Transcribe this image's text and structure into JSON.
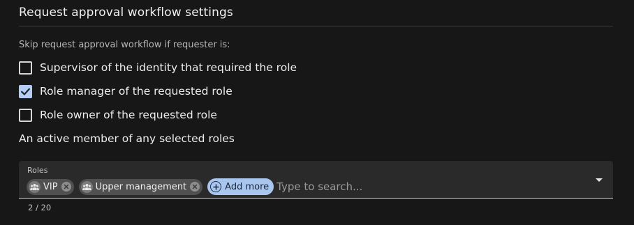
{
  "section": {
    "title": "Request approval workflow settings",
    "subheading": "Skip request approval workflow if requester is:"
  },
  "options": [
    {
      "label": "Supervisor of the identity that required the role",
      "checked": false
    },
    {
      "label": "Role manager of the requested role",
      "checked": true
    },
    {
      "label": "Role owner of the requested role",
      "checked": false
    }
  ],
  "active_member_label": "An active member of any selected roles",
  "roles_field": {
    "label": "Roles",
    "chips": [
      {
        "text": "VIP",
        "icon": "group-icon"
      },
      {
        "text": "Upper management",
        "icon": "group-icon"
      }
    ],
    "add_more_label": "Add more",
    "placeholder": "Type to search...",
    "counter": "2 / 20"
  },
  "colors": {
    "background": "#171717",
    "checkbox_checked": "#b5cdf2",
    "add_more_chip": "#a9c6ef",
    "chip": "#505050"
  }
}
